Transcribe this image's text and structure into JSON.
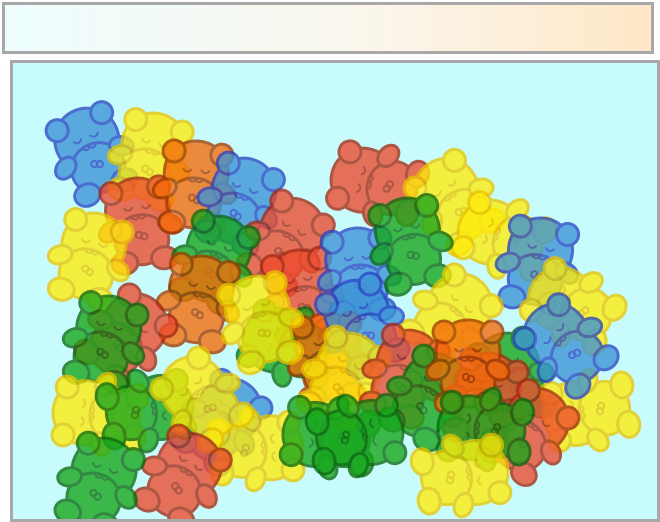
{
  "game": {
    "palette": {
      "jar_background": "#c8fbfb",
      "frame_border": "#a8a8a8",
      "bar_gradient_left": "#eefeff",
      "bar_gradient_right": "#ffe7c6"
    },
    "bear_colors": {
      "red": {
        "fill": "#ee4a2c",
        "stroke": "#a52a14"
      },
      "orange": {
        "fill": "#f56a08",
        "stroke": "#a33a00"
      },
      "yellow": {
        "fill": "#ffec0a",
        "stroke": "#e8c400"
      },
      "green": {
        "fill": "#16a61a",
        "stroke": "#0a6a10"
      },
      "blue": {
        "fill": "#3b93d6",
        "stroke": "#2946c4"
      }
    },
    "bears": [
      {
        "color": "blue",
        "angle": -22
      },
      {
        "color": "yellow",
        "angle": 15
      },
      {
        "color": "red",
        "angle": -8
      },
      {
        "color": "orange",
        "angle": 5
      },
      {
        "color": "blue",
        "angle": 20
      },
      {
        "color": "red",
        "angle": -75
      },
      {
        "color": "yellow",
        "angle": -35
      },
      {
        "color": "red",
        "angle": 30
      },
      {
        "color": "yellow",
        "angle": -70
      },
      {
        "color": "green",
        "angle": 20
      },
      {
        "color": "red",
        "angle": -10
      },
      {
        "color": "blue",
        "angle": -5
      },
      {
        "color": "green",
        "angle": -12
      },
      {
        "color": "yellow",
        "angle": 15
      },
      {
        "color": "orange",
        "angle": 10
      },
      {
        "color": "blue",
        "angle": 10
      },
      {
        "color": "red",
        "angle": 40
      },
      {
        "color": "green",
        "angle": -70
      },
      {
        "color": "yellow",
        "angle": 40
      },
      {
        "color": "orange",
        "angle": -5
      },
      {
        "color": "yellow",
        "angle": -15
      },
      {
        "color": "blue",
        "angle": -25
      },
      {
        "color": "yellow",
        "angle": -60
      },
      {
        "color": "yellow",
        "angle": 25
      },
      {
        "color": "green",
        "angle": 15
      },
      {
        "color": "red",
        "angle": 20
      },
      {
        "color": "green",
        "angle": -20
      },
      {
        "color": "blue",
        "angle": 35
      },
      {
        "color": "green",
        "angle": 30
      },
      {
        "color": "red",
        "angle": 15
      },
      {
        "color": "yellow",
        "angle": -85
      },
      {
        "color": "yellow",
        "angle": -100
      },
      {
        "color": "green",
        "angle": 80
      },
      {
        "color": "red",
        "angle": 35
      },
      {
        "color": "yellow",
        "angle": 85
      },
      {
        "color": "orange",
        "angle": 0
      },
      {
        "color": "yellow",
        "angle": -40
      },
      {
        "color": "green",
        "angle": -80
      },
      {
        "color": "blue",
        "angle": -45
      },
      {
        "color": "green",
        "angle": -85
      },
      {
        "color": "yellow",
        "angle": 80
      },
      {
        "color": "red",
        "angle": 30
      },
      {
        "color": "green",
        "angle": 20
      },
      {
        "color": "green",
        "angle": 80
      }
    ]
  }
}
